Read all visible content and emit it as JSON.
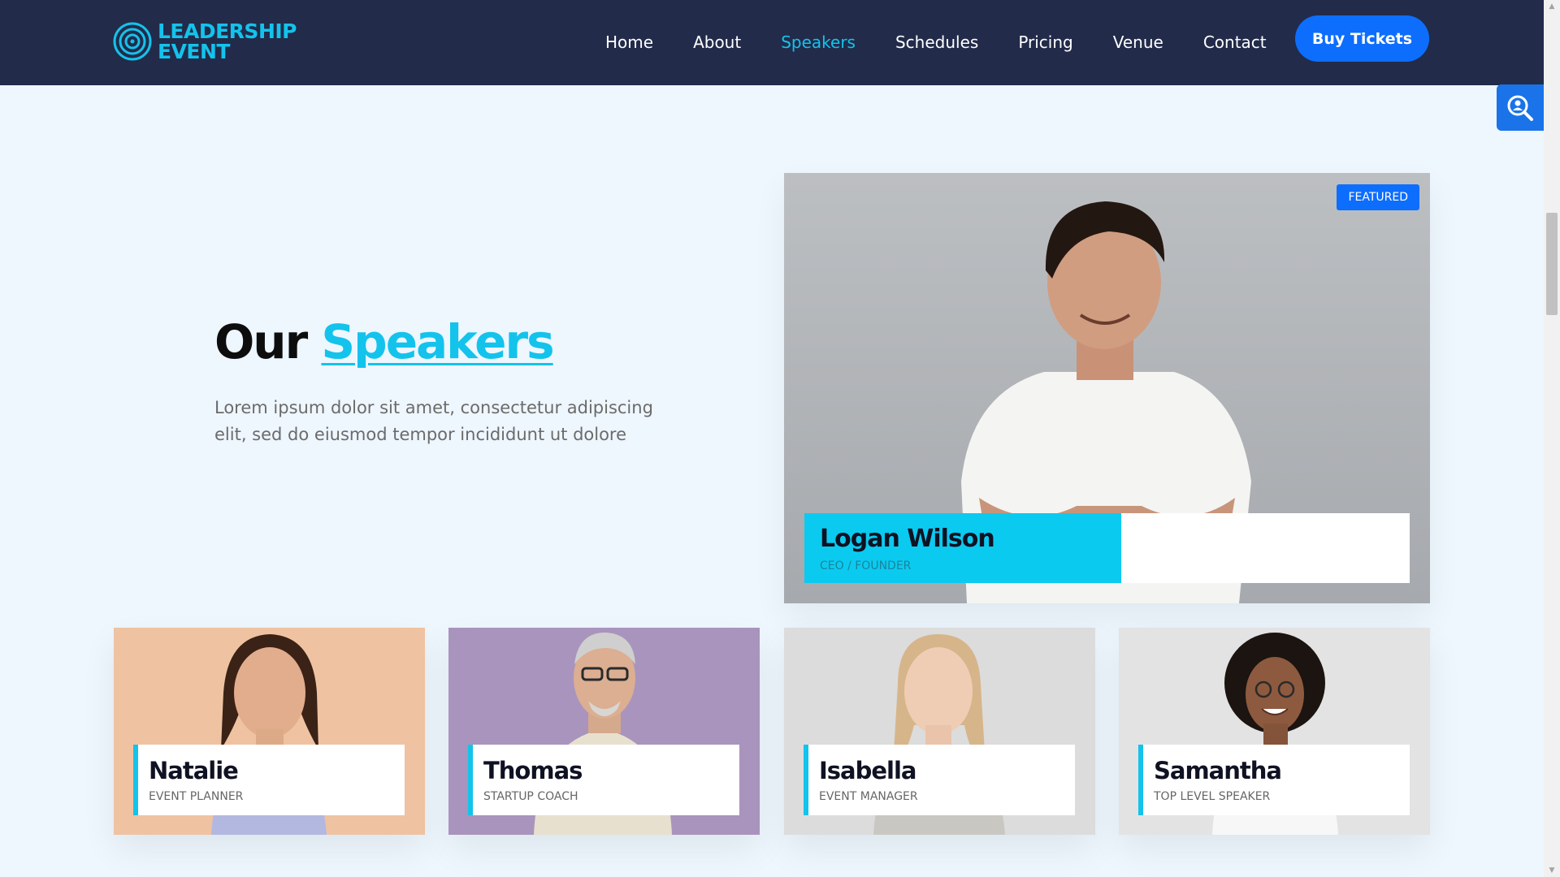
{
  "brand": {
    "line1": "LEADERSHIP",
    "line2": "EVENT",
    "accent": "#13c3ec",
    "header_bg": "#222b4a"
  },
  "nav": {
    "items": [
      {
        "label": "Home"
      },
      {
        "label": "About"
      },
      {
        "label": "Speakers",
        "active": true
      },
      {
        "label": "Schedules"
      },
      {
        "label": "Pricing"
      },
      {
        "label": "Venue"
      },
      {
        "label": "Contact"
      }
    ],
    "cta": "Buy Tickets"
  },
  "intro": {
    "title_plain": "Our",
    "title_accent": "Speakers",
    "text": "Lorem ipsum dolor sit amet, consectetur adipiscing elit, sed do eiusmod tempor incididunt ut dolore"
  },
  "featured": {
    "badge": "FEATURED",
    "name": "Logan Wilson",
    "role": "CEO / FOUNDER"
  },
  "speakers": [
    {
      "name": "Natalie",
      "role": "EVENT PLANNER"
    },
    {
      "name": "Thomas",
      "role": "STARTUP COACH"
    },
    {
      "name": "Isabella",
      "role": "EVENT MANAGER"
    },
    {
      "name": "Samantha",
      "role": "TOP LEVEL SPEAKER"
    }
  ],
  "icons": {
    "logo": "concentric-circles-icon",
    "search_widget": "person-search-icon"
  }
}
